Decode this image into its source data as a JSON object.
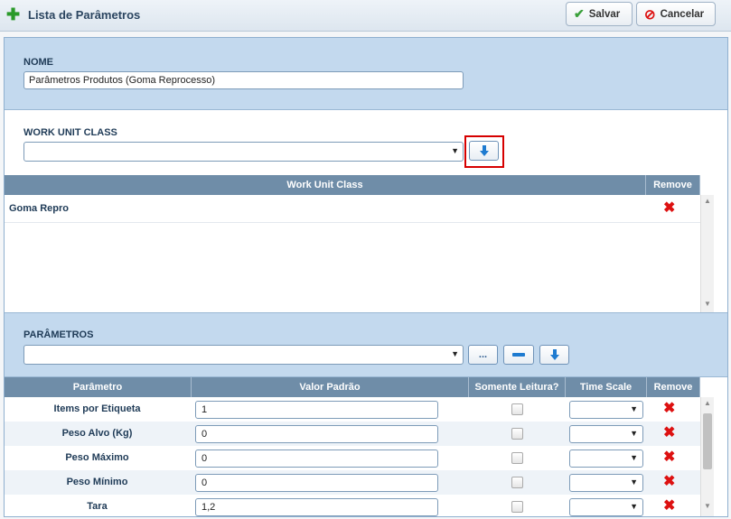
{
  "window": {
    "title": "Lista de Parâmetros"
  },
  "toolbar": {
    "save_label": "Salvar",
    "cancel_label": "Cancelar"
  },
  "nome": {
    "label": "NOME",
    "value": "Parâmetros Produtos (Goma Reprocesso)"
  },
  "work_unit_class": {
    "label": "WORK UNIT CLASS",
    "selected": "",
    "columns": [
      "Work Unit Class",
      "Remove"
    ],
    "rows": [
      {
        "name": "Goma Repro"
      }
    ]
  },
  "parametros": {
    "label": "PARÂMETROS",
    "selected": "",
    "more_button": "...",
    "columns": [
      "Parâmetro",
      "Valor Padrão",
      "Somente Leitura?",
      "Time Scale",
      "Remove"
    ],
    "rows": [
      {
        "name": "Items por Etiqueta",
        "value": "1",
        "read_only": false,
        "time_scale": ""
      },
      {
        "name": "Peso Alvo (Kg)",
        "value": "0",
        "read_only": false,
        "time_scale": ""
      },
      {
        "name": "Peso Máximo",
        "value": "0",
        "read_only": false,
        "time_scale": ""
      },
      {
        "name": "Peso Mínimo",
        "value": "0",
        "read_only": false,
        "time_scale": ""
      },
      {
        "name": "Tara",
        "value": "1,2",
        "read_only": false,
        "time_scale": ""
      }
    ]
  },
  "colors": {
    "header_bg": "#6f8da8",
    "panel_bg": "#c3d9ee",
    "accent_red": "#d60000",
    "icon_blue": "#1e7bd0"
  },
  "icons": {
    "add": "plus-icon",
    "save": "checkmark-icon",
    "cancel": "no-entry-icon",
    "add_down": "arrow-down-icon",
    "remove": "red-x-icon",
    "remove_minus": "minus-icon"
  }
}
